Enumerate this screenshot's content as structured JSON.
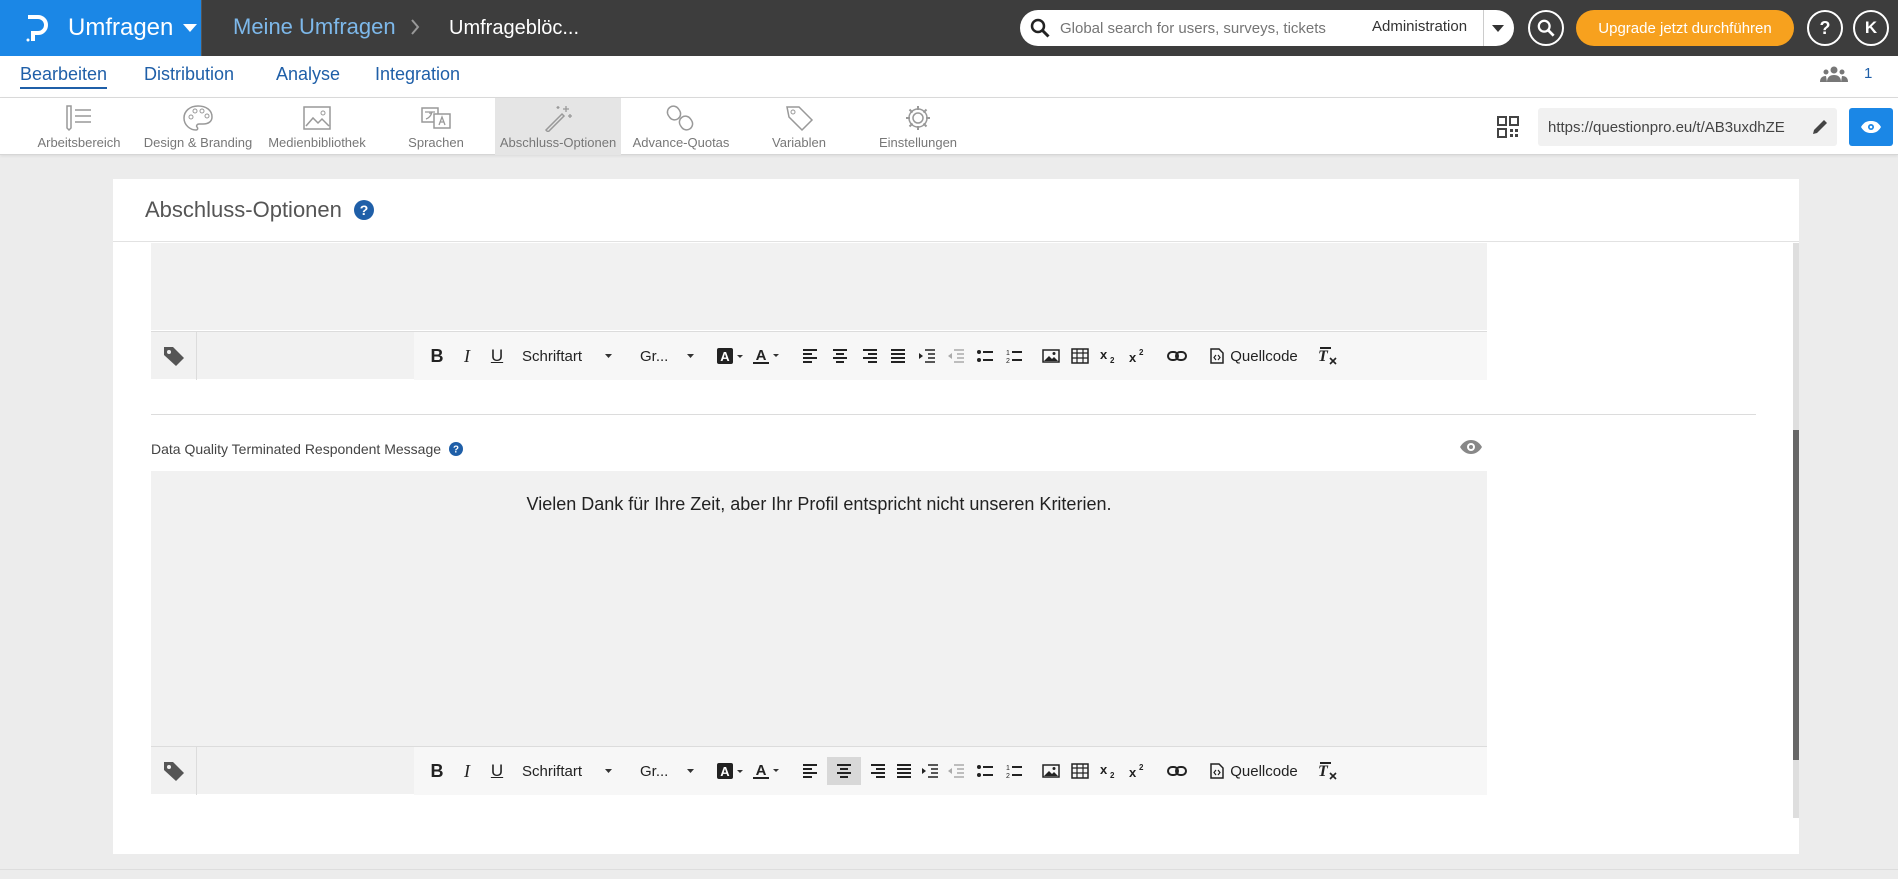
{
  "topbar": {
    "app_name": "Umfragen",
    "breadcrumb_root": "Meine Umfragen",
    "breadcrumb_current": "Umfrageblöc...",
    "search_placeholder": "Global search for users, surveys, tickets",
    "search_scope": "Administration",
    "upgrade_label": "Upgrade jetzt durchführen",
    "help_label": "?",
    "avatar_initial": "K"
  },
  "main_nav": {
    "tabs": [
      "Bearbeiten",
      "Distribution",
      "Analyse",
      "Integration"
    ],
    "active": "Bearbeiten",
    "collaborator_count": "1"
  },
  "toolbar": {
    "tools": [
      {
        "label": "Arbeitsbereich",
        "icon": "list-icon"
      },
      {
        "label": "Design & Branding",
        "icon": "palette-icon"
      },
      {
        "label": "Medienbibliothek",
        "icon": "image-icon"
      },
      {
        "label": "Sprachen",
        "icon": "translate-icon"
      },
      {
        "label": "Abschluss-Optionen",
        "icon": "magic-wand-icon"
      },
      {
        "label": "Advance-Quotas",
        "icon": "chain-icon"
      },
      {
        "label": "Variablen",
        "icon": "tag-icon"
      },
      {
        "label": "Einstellungen",
        "icon": "gear-icon"
      }
    ],
    "active": "Abschluss-Optionen",
    "survey_url": "https://questionpro.eu/t/AB3uxdhZE"
  },
  "card": {
    "title": "Abschluss-Optionen",
    "section_label": "Data Quality Terminated Respondent Message",
    "message": "Vielen Dank für Ihre Zeit, aber Ihr Profil entspricht nicht unseren Kriterien."
  },
  "editor_toolbar": {
    "font_label": "Schriftart",
    "size_label": "Gr...",
    "source_label": "Quellcode"
  },
  "colors": {
    "brand_blue": "#1b87e6",
    "topbar_dark": "#3d3d3d",
    "upgrade_orange": "#f7a11e",
    "nav_blue": "#1f5fa8"
  }
}
